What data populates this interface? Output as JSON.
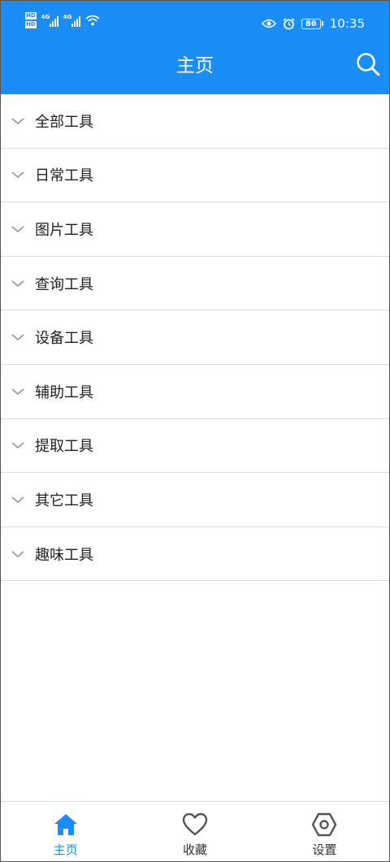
{
  "status_bar": {
    "hd_label": "HD",
    "net_label": "4G",
    "battery_level": "86",
    "time": "10:35"
  },
  "header": {
    "title": "主页",
    "search_icon": "search-icon"
  },
  "categories": [
    {
      "label": "全部工具"
    },
    {
      "label": "日常工具"
    },
    {
      "label": "图片工具"
    },
    {
      "label": "查询工具"
    },
    {
      "label": "设备工具"
    },
    {
      "label": "辅助工具"
    },
    {
      "label": "提取工具"
    },
    {
      "label": "其它工具"
    },
    {
      "label": "趣味工具"
    }
  ],
  "tabbar": {
    "items": [
      {
        "label": "主页",
        "icon": "home-icon",
        "active": true
      },
      {
        "label": "收藏",
        "icon": "heart-icon",
        "active": false
      },
      {
        "label": "设置",
        "icon": "settings-hexagon-icon",
        "active": false
      }
    ]
  },
  "colors": {
    "accent": "#1a8df7",
    "divider": "#dcdcdc",
    "text": "#222222",
    "icon_gray": "#555555"
  }
}
